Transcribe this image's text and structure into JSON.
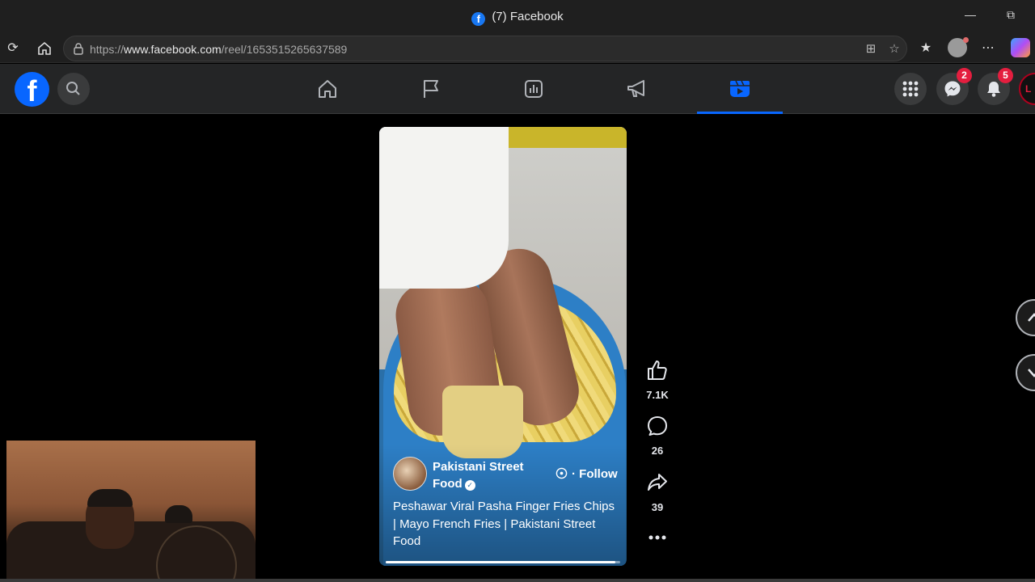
{
  "browser": {
    "tab_title": "(7) Facebook",
    "url_prefix": "https://",
    "url_domain": "www.facebook.com",
    "url_path": "/reel/1653515265637589"
  },
  "fb_nav": {
    "logo_letter": "f",
    "tabs": [
      {
        "name": "home",
        "icon": "home-icon"
      },
      {
        "name": "pages",
        "icon": "flag-icon"
      },
      {
        "name": "ads-manager",
        "icon": "chart-icon"
      },
      {
        "name": "marketing",
        "icon": "megaphone-icon"
      },
      {
        "name": "video",
        "icon": "video-icon",
        "active": true
      }
    ],
    "messenger_badge": "2",
    "notifications_badge": "5",
    "profile_text": "L"
  },
  "reel": {
    "page_name": "Pakistani Street Food",
    "follow_label": "Follow",
    "follow_separator": "·",
    "caption": "Peshawar Viral Pasha Finger Fries Chips | Mayo French Fries | Pakistani Street Food",
    "progress": 0.98,
    "likes": "7.1K",
    "comments": "26",
    "shares": "39"
  },
  "colors": {
    "fb_blue": "#0866ff",
    "badge_red": "#e41e3f",
    "nav_bg": "#242526"
  }
}
